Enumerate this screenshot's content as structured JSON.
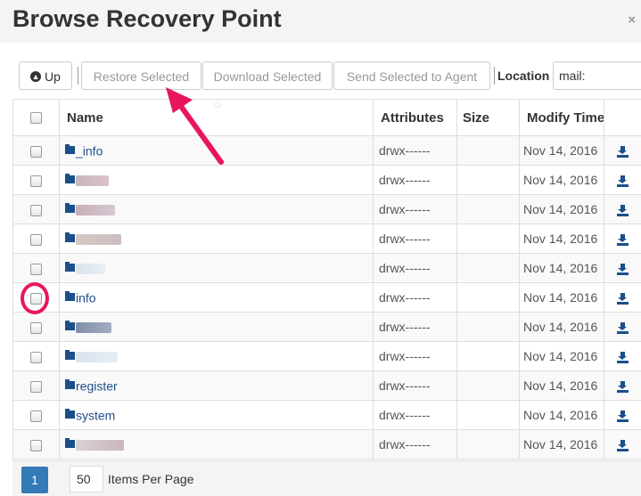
{
  "dialog": {
    "title": "Browse Recovery Point",
    "close_glyph": "×"
  },
  "toolbar": {
    "up_label": "Up",
    "restore_label": "Restore Selected",
    "download_label": "Download Selected",
    "send_label": "Send Selected to Agent",
    "location_label": "Location",
    "location_value": "mail:"
  },
  "table": {
    "headers": {
      "name": "Name",
      "attributes": "Attributes",
      "size": "Size",
      "modify": "Modify Time"
    },
    "rows": [
      {
        "name": "_info",
        "blurred": false,
        "attributes": "drwx------",
        "size": "",
        "modified": "Nov 14, 2016"
      },
      {
        "name": "",
        "blurred": true,
        "attributes": "drwx------",
        "size": "",
        "modified": "Nov 14, 2016"
      },
      {
        "name": "",
        "blurred": true,
        "attributes": "drwx------",
        "size": "",
        "modified": "Nov 14, 2016"
      },
      {
        "name": "",
        "blurred": true,
        "attributes": "drwx------",
        "size": "",
        "modified": "Nov 14, 2016"
      },
      {
        "name": "",
        "blurred": true,
        "attributes": "drwx------",
        "size": "",
        "modified": "Nov 14, 2016"
      },
      {
        "name": "info",
        "blurred": false,
        "attributes": "drwx------",
        "size": "",
        "modified": "Nov 14, 2016"
      },
      {
        "name": "",
        "blurred": true,
        "attributes": "drwx------",
        "size": "",
        "modified": "Nov 14, 2016"
      },
      {
        "name": "",
        "blurred": true,
        "attributes": "drwx------",
        "size": "",
        "modified": "Nov 14, 2016"
      },
      {
        "name": "register",
        "blurred": false,
        "attributes": "drwx------",
        "size": "",
        "modified": "Nov 14, 2016"
      },
      {
        "name": "system",
        "blurred": false,
        "attributes": "drwx------",
        "size": "",
        "modified": "Nov 14, 2016"
      },
      {
        "name": "",
        "blurred": true,
        "attributes": "drwx------",
        "size": "",
        "modified": "Nov 14, 2016"
      }
    ]
  },
  "pagination": {
    "current_page": "1",
    "per_page": "50",
    "per_page_label": "Items Per Page"
  },
  "colors": {
    "accent": "#337ab7",
    "folder": "#1a4f8a",
    "annotation": "#e8175d"
  },
  "icons": {
    "up": "circle-arrow-up-icon",
    "folder": "folder-icon",
    "download": "download-icon"
  }
}
